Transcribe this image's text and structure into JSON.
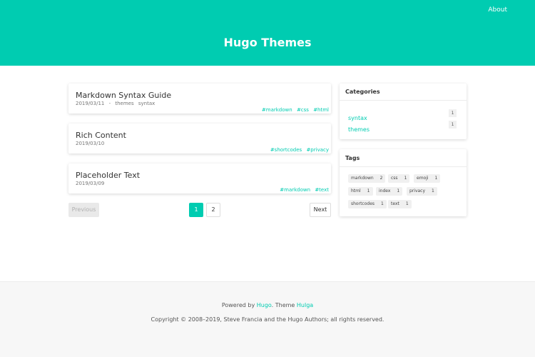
{
  "header": {
    "title": "Hugo Themes",
    "nav_about": "About",
    "background_color": "#00ccb1"
  },
  "posts": [
    {
      "title": "Markdown Syntax Guide",
      "date": "2019/03/11",
      "separator": "-",
      "categories": [
        "themes",
        "syntax"
      ],
      "tags": [
        "#markdown",
        "#css",
        "#html"
      ]
    },
    {
      "title": "Rich Content",
      "date": "2019/03/10",
      "tags": [
        "#shortcodes",
        "#privacy"
      ]
    },
    {
      "title": "Placeholder Text",
      "date": "2019/03/09",
      "tags": [
        "#markdown",
        "#text"
      ]
    }
  ],
  "pagination": {
    "previous": "Previous",
    "pages": [
      "1",
      "2"
    ],
    "current_page": "1",
    "next": "Next"
  },
  "sidebar": {
    "categories": {
      "title": "Categories",
      "items": [
        {
          "name": "syntax",
          "count": "1"
        },
        {
          "name": "themes",
          "count": "1"
        }
      ]
    },
    "tags": {
      "title": "Tags",
      "items": [
        {
          "name": "markdown",
          "count": "2"
        },
        {
          "name": "css",
          "count": "1"
        },
        {
          "name": "emoji",
          "count": "1"
        },
        {
          "name": "html",
          "count": "1"
        },
        {
          "name": "index",
          "count": "1"
        },
        {
          "name": "privacy",
          "count": "1"
        },
        {
          "name": "shortcodes",
          "count": "1"
        },
        {
          "name": "text",
          "count": "1"
        }
      ]
    }
  },
  "footer": {
    "powered_prefix": "Powered by",
    "hugo_link": "Hugo",
    "theme_prefix": ". Theme",
    "theme_link": "Hulga",
    "copyright": "Copyright © 2008–2019, Steve Francia and the Hugo Authors; all rights reserved."
  }
}
